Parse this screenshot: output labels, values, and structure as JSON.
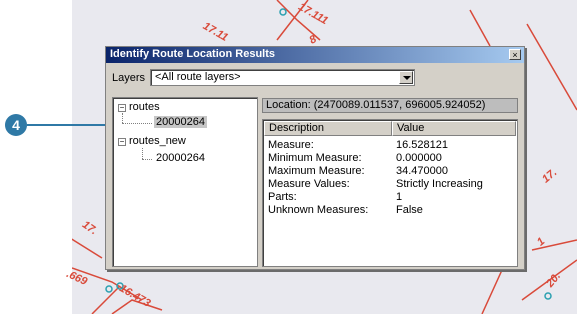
{
  "map": {
    "labels": [
      "17.111",
      "17.11",
      "8",
      "17.",
      "17.",
      ".669",
      "16.473",
      "1",
      "20."
    ],
    "callout_number": "4"
  },
  "dialog": {
    "title": "Identify Route Location Results",
    "close_glyph": "×",
    "layers_label": "Layers",
    "layers_value": "<All route layers>",
    "tree": [
      {
        "label": "routes",
        "expander": "−",
        "children": [
          "20000264"
        ]
      },
      {
        "label": "routes_new",
        "expander": "−",
        "children": [
          "20000264"
        ]
      }
    ],
    "location": "Location: (2470089.011537, 696005.924052)",
    "columns": {
      "description": "Description",
      "value": "Value"
    },
    "rows": [
      {
        "desc": "Measure:",
        "val": "16.528121"
      },
      {
        "desc": "Minimum Measure:",
        "val": "0.000000"
      },
      {
        "desc": "Maximum Measure:",
        "val": "34.470000"
      },
      {
        "desc": "Measure Values:",
        "val": "Strictly Increasing"
      },
      {
        "desc": "Parts:",
        "val": "1"
      },
      {
        "desc": "Unknown Measures:",
        "val": "False"
      }
    ]
  },
  "colors": {
    "route_line": "#d94a3a",
    "point": "#2aa0b0",
    "callout": "#2f79a6",
    "title_bar_start": "#0a246a"
  }
}
